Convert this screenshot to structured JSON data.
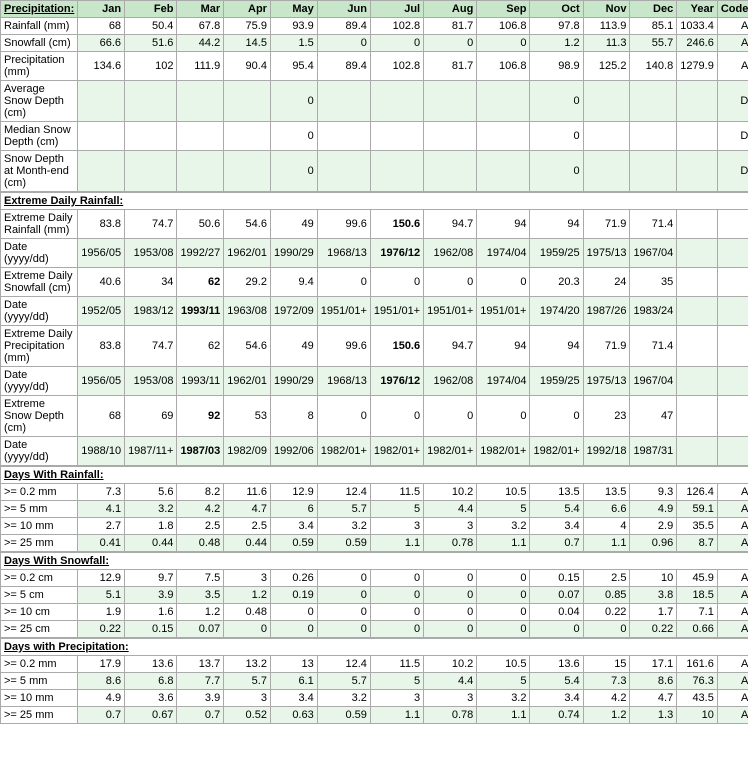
{
  "headers": {
    "col0": "Precipitation:",
    "months": [
      "Jan",
      "Feb",
      "Mar",
      "Apr",
      "May",
      "Jun",
      "Jul",
      "Aug",
      "Sep",
      "Oct",
      "Nov",
      "Dec",
      "Year",
      "Code"
    ]
  },
  "rows": [
    {
      "label": "Rainfall (mm)",
      "values": [
        "68",
        "50.4",
        "67.8",
        "75.9",
        "93.9",
        "89.4",
        "102.8",
        "81.7",
        "106.8",
        "97.8",
        "113.9",
        "85.1",
        "1033.4",
        "A"
      ],
      "style": "normal"
    },
    {
      "label": "Snowfall (cm)",
      "values": [
        "66.6",
        "51.6",
        "44.2",
        "14.5",
        "1.5",
        "0",
        "0",
        "0",
        "0",
        "1.2",
        "11.3",
        "55.7",
        "246.6",
        "A"
      ],
      "style": "alt"
    },
    {
      "label": "Precipitation (mm)",
      "values": [
        "134.6",
        "102",
        "111.9",
        "90.4",
        "95.4",
        "89.4",
        "102.8",
        "81.7",
        "106.8",
        "98.9",
        "125.2",
        "140.8",
        "1279.9",
        "A"
      ],
      "style": "normal"
    },
    {
      "label": "Average Snow Depth (cm)",
      "values": [
        "",
        "",
        "",
        "",
        "0",
        "",
        "",
        "",
        "",
        "0",
        "",
        "",
        "",
        "D"
      ],
      "style": "alt"
    },
    {
      "label": "Median Snow Depth (cm)",
      "values": [
        "",
        "",
        "",
        "",
        "0",
        "",
        "",
        "",
        "",
        "0",
        "",
        "",
        "",
        "D"
      ],
      "style": "normal"
    },
    {
      "label": "Snow Depth at Month-end (cm)",
      "values": [
        "",
        "",
        "",
        "",
        "0",
        "",
        "",
        "",
        "",
        "0",
        "",
        "",
        "",
        "D"
      ],
      "style": "alt"
    },
    {
      "section": "extreme_daily_rainfall"
    },
    {
      "label": "Extreme Daily Rainfall (mm)",
      "values": [
        "83.8",
        "74.7",
        "50.6",
        "54.6",
        "49",
        "99.6",
        "150.6",
        "94.7",
        "94",
        "94",
        "71.9",
        "71.4",
        "",
        ""
      ],
      "bold_col": 6,
      "style": "normal"
    },
    {
      "label": "Date (yyyy/dd)",
      "values": [
        "1956/05",
        "1953/08",
        "1992/27",
        "1962/01",
        "1990/29",
        "1968/13",
        "1976/12",
        "1962/08",
        "1974/04",
        "1959/25",
        "1975/13",
        "1967/04",
        "",
        ""
      ],
      "bold_col": 6,
      "style": "alt"
    },
    {
      "label": "Extreme Daily Snowfall (cm)",
      "values": [
        "40.6",
        "34",
        "62",
        "29.2",
        "9.4",
        "0",
        "0",
        "0",
        "0",
        "20.3",
        "24",
        "35",
        "",
        ""
      ],
      "bold_col": 2,
      "style": "normal"
    },
    {
      "label": "Date (yyyy/dd)",
      "values": [
        "1952/05",
        "1983/12",
        "1993/11",
        "1963/08",
        "1972/09",
        "1951/01+",
        "1951/01+",
        "1951/01+",
        "1951/01+",
        "1974/20",
        "1987/26",
        "1983/24",
        "",
        ""
      ],
      "bold_col": 2,
      "style": "alt"
    },
    {
      "label": "Extreme Daily Precipitation (mm)",
      "values": [
        "83.8",
        "74.7",
        "62",
        "54.6",
        "49",
        "99.6",
        "150.6",
        "94.7",
        "94",
        "94",
        "71.9",
        "71.4",
        "",
        ""
      ],
      "bold_col": 6,
      "style": "normal"
    },
    {
      "label": "Date (yyyy/dd)",
      "values": [
        "1956/05",
        "1953/08",
        "1993/11",
        "1962/01",
        "1990/29",
        "1968/13",
        "1976/12",
        "1962/08",
        "1974/04",
        "1959/25",
        "1975/13",
        "1967/04",
        "",
        ""
      ],
      "bold_col": 6,
      "style": "alt"
    },
    {
      "label": "Extreme Snow Depth (cm)",
      "values": [
        "68",
        "69",
        "92",
        "53",
        "8",
        "0",
        "0",
        "0",
        "0",
        "0",
        "23",
        "47",
        "",
        ""
      ],
      "bold_col": 2,
      "style": "normal"
    },
    {
      "label": "Date (yyyy/dd)",
      "values": [
        "1988/10",
        "1987/11+",
        "1987/03",
        "1982/09",
        "1992/06",
        "1982/01+",
        "1982/01+",
        "1982/01+",
        "1982/01+",
        "1982/01+",
        "1992/18",
        "1987/31",
        "",
        ""
      ],
      "bold_col": 2,
      "style": "alt"
    },
    {
      "section": "days_with_rainfall"
    },
    {
      "label": ">= 0.2 mm",
      "values": [
        "7.3",
        "5.6",
        "8.2",
        "11.6",
        "12.9",
        "12.4",
        "11.5",
        "10.2",
        "10.5",
        "13.5",
        "13.5",
        "9.3",
        "126.4",
        "A"
      ],
      "style": "normal"
    },
    {
      "label": ">= 5 mm",
      "values": [
        "4.1",
        "3.2",
        "4.2",
        "4.7",
        "6",
        "5.7",
        "5",
        "4.4",
        "5",
        "5.4",
        "6.6",
        "4.9",
        "59.1",
        "A"
      ],
      "style": "alt"
    },
    {
      "label": ">= 10 mm",
      "values": [
        "2.7",
        "1.8",
        "2.5",
        "2.5",
        "3.4",
        "3.2",
        "3",
        "3",
        "3.2",
        "3.4",
        "4",
        "2.9",
        "35.5",
        "A"
      ],
      "style": "normal"
    },
    {
      "label": ">= 25 mm",
      "values": [
        "0.41",
        "0.44",
        "0.48",
        "0.44",
        "0.59",
        "0.59",
        "1.1",
        "0.78",
        "1.1",
        "0.7",
        "1.1",
        "0.96",
        "8.7",
        "A"
      ],
      "style": "alt"
    },
    {
      "section": "days_with_snowfall"
    },
    {
      "label": ">= 0.2 cm",
      "values": [
        "12.9",
        "9.7",
        "7.5",
        "3",
        "0.26",
        "0",
        "0",
        "0",
        "0",
        "0.15",
        "2.5",
        "10",
        "45.9",
        "A"
      ],
      "style": "normal"
    },
    {
      "label": ">= 5 cm",
      "values": [
        "5.1",
        "3.9",
        "3.5",
        "1.2",
        "0.19",
        "0",
        "0",
        "0",
        "0",
        "0.07",
        "0.85",
        "3.8",
        "18.5",
        "A"
      ],
      "style": "alt"
    },
    {
      "label": ">= 10 cm",
      "values": [
        "1.9",
        "1.6",
        "1.2",
        "0.48",
        "0",
        "0",
        "0",
        "0",
        "0",
        "0.04",
        "0.22",
        "1.7",
        "7.1",
        "A"
      ],
      "style": "normal"
    },
    {
      "label": ">= 25 cm",
      "values": [
        "0.22",
        "0.15",
        "0.07",
        "0",
        "0",
        "0",
        "0",
        "0",
        "0",
        "0",
        "0",
        "0.22",
        "0.66",
        "A"
      ],
      "style": "alt"
    },
    {
      "section": "days_with_precipitation"
    },
    {
      "label": ">= 0.2 mm",
      "values": [
        "17.9",
        "13.6",
        "13.7",
        "13.2",
        "13",
        "12.4",
        "11.5",
        "10.2",
        "10.5",
        "13.6",
        "15",
        "17.1",
        "161.6",
        "A"
      ],
      "style": "normal"
    },
    {
      "label": ">= 5 mm",
      "values": [
        "8.6",
        "6.8",
        "7.7",
        "5.7",
        "6.1",
        "5.7",
        "5",
        "4.4",
        "5",
        "5.4",
        "7.3",
        "8.6",
        "76.3",
        "A"
      ],
      "style": "alt"
    },
    {
      "label": ">= 10 mm",
      "values": [
        "4.9",
        "3.6",
        "3.9",
        "3",
        "3.4",
        "3.2",
        "3",
        "3",
        "3.2",
        "3.4",
        "4.2",
        "4.7",
        "43.5",
        "A"
      ],
      "style": "normal"
    },
    {
      "label": ">= 25 mm",
      "values": [
        "0.7",
        "0.67",
        "0.7",
        "0.52",
        "0.63",
        "0.59",
        "1.1",
        "0.78",
        "1.1",
        "0.74",
        "1.2",
        "1.3",
        "10",
        "A"
      ],
      "style": "alt"
    }
  ],
  "section_labels": {
    "extreme_daily_rainfall": "Extreme Daily Rainfall:",
    "days_with_rainfall": "Days With Rainfall:",
    "days_with_snowfall": "Days With Snowfall:",
    "days_with_precipitation": "Days with Precipitation:"
  }
}
